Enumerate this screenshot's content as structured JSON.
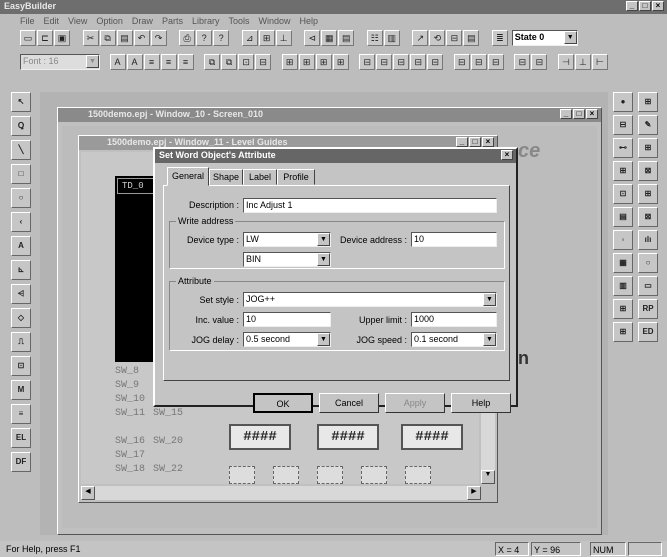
{
  "app": {
    "title": "EasyBuilder"
  },
  "menu": [
    "File",
    "Edit",
    "View",
    "Option",
    "Draw",
    "Parts",
    "Library",
    "Tools",
    "Window",
    "Help"
  ],
  "toolbar": {
    "state_label": "State 0",
    "font_label": "Font : 16"
  },
  "left_tools": [
    "↖",
    "Ꝗ",
    "╲",
    "□",
    "○",
    "‹",
    "A",
    "⊾",
    "⩤",
    "◇",
    "⎍",
    "⊡",
    "M",
    "≡",
    "EL",
    "DF"
  ],
  "right_tools_a": [
    "●",
    "⊟",
    "⊷",
    "⊞",
    "⊡",
    "▤",
    "◦",
    "▦",
    "▥",
    "⊞",
    "⊞"
  ],
  "right_tools_b": [
    "⊞",
    "✎",
    "⊞",
    "⊠",
    "⊞",
    "⊠",
    "ılı",
    "○",
    "▭",
    "RP",
    "ED"
  ],
  "win_outer": {
    "title": "1500demo.epj - Window_10 - Screen_010"
  },
  "win_inner": {
    "title": "1500demo.epj - Window_11 - Level Guides"
  },
  "canvas": {
    "td": "TD_0",
    "sw_a": [
      "SW_8",
      "SW_9",
      "SW_10",
      "SW_11",
      "SW_16",
      "SW_17",
      "SW_18"
    ],
    "sw_b": [
      "SW_15",
      "SW_20",
      "SW_22"
    ],
    "hash": "####",
    "stray_a": "ce",
    "stray_b": "n"
  },
  "dialog": {
    "title": "Set Word Object's Attribute",
    "tabs": [
      "General",
      "Shape",
      "Label",
      "Profile"
    ],
    "description_label": "Description :",
    "description": "Inc Adjust 1",
    "write_group": "Write address",
    "device_type_label": "Device type :",
    "device_type": "LW",
    "device_address_label": "Device address :",
    "device_address": "10",
    "format": "BIN",
    "attr_group": "Attribute",
    "set_style_label": "Set style :",
    "set_style": "JOG++",
    "inc_label": "Inc. value :",
    "inc_value": "10",
    "upper_label": "Upper limit :",
    "upper_value": "1000",
    "jog_delay_label": "JOG delay :",
    "jog_delay": "0.5 second",
    "jog_speed_label": "JOG speed :",
    "jog_speed": "0.1 second",
    "ok": "OK",
    "cancel": "Cancel",
    "apply": "Apply",
    "help": "Help"
  },
  "status": {
    "hint": "For Help, press F1",
    "x": "X = 4",
    "y": "Y = 96",
    "num": "NUM"
  }
}
